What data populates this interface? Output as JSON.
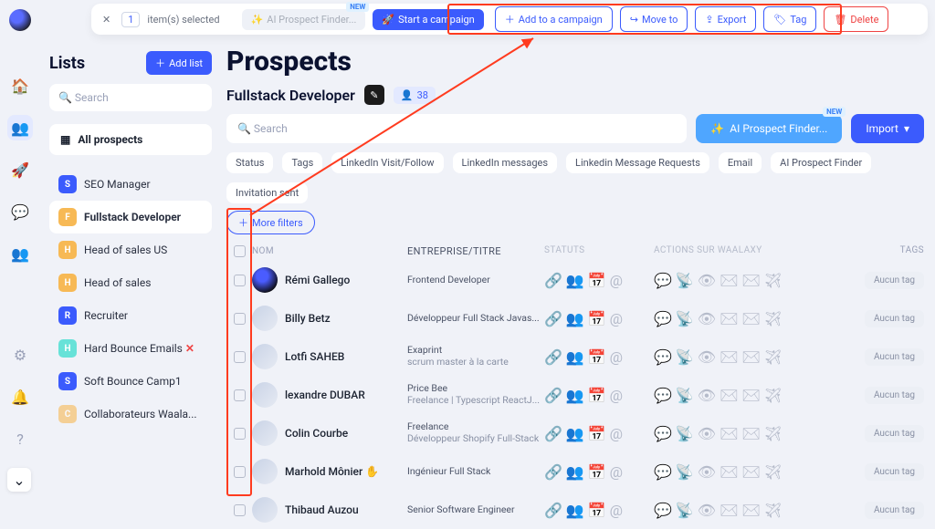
{
  "topbar": {
    "selected_count": "1",
    "selected_label": "item(s) selected",
    "ai_btn": "AI Prospect Finder...",
    "new_badge": "NEW",
    "start_campaign": "Start a campaign",
    "add_to_campaign": "Add to a campaign",
    "move_to": "Move to",
    "export": "Export",
    "tag": "Tag",
    "delete": "Delete"
  },
  "sidebar": {
    "title": "Lists",
    "add_list": "Add list",
    "search_placeholder": "Search",
    "all_prospects": "All prospects",
    "items": [
      {
        "initial": "S",
        "cls": "la-s",
        "label": "SEO Manager"
      },
      {
        "initial": "F",
        "cls": "la-f",
        "label": "Fullstack Developer",
        "active": true
      },
      {
        "initial": "H",
        "cls": "la-h",
        "label": "Head of sales US"
      },
      {
        "initial": "H",
        "cls": "la-h",
        "label": "Head of sales"
      },
      {
        "initial": "R",
        "cls": "la-r",
        "label": "Recruiter"
      },
      {
        "initial": "H",
        "cls": "la-h2",
        "label": "Hard Bounce Emails",
        "x": true
      },
      {
        "initial": "S",
        "cls": "la-s",
        "label": "Soft Bounce Camp1"
      },
      {
        "initial": "C",
        "cls": "la-c",
        "label": "Collaborateurs Waala..."
      }
    ]
  },
  "main": {
    "heading": "Prospects",
    "subtitle": "Fullstack Developer",
    "count": "38",
    "search_placeholder": "Search",
    "ai_finder": "AI Prospect Finder...",
    "new_badge": "NEW",
    "import": "Import",
    "filters": [
      "Status",
      "Tags",
      "LinkedIn Visit/Follow",
      "LinkedIn messages",
      "Linkedin Message Requests",
      "Email",
      "AI Prospect Finder",
      "Invitation sent"
    ],
    "more_filters": "More filters",
    "columns": {
      "nom": "NOM",
      "ent": "ENTREPRISE/TITRE",
      "stat": "STATUTS",
      "act": "ACTIONS SUR WAALAXY",
      "tag": "TAGS"
    },
    "no_tag": "Aucun tag",
    "rows": [
      {
        "name": "Rémi Gallego",
        "l1": "Frontend Developer",
        "l2": "",
        "alien": true
      },
      {
        "name": "Billy Betz",
        "l1": "Développeur Full Stack Javas...",
        "l2": ""
      },
      {
        "name": "Lotfi SAHEB",
        "l1": "Exaprint",
        "l2": "scrum master à la carte"
      },
      {
        "name": "lexandre DUBAR",
        "l1": "Price Bee",
        "l2": "Freelance | Typescript ReactJ...",
        "apple": true
      },
      {
        "name": "Colin Courbe",
        "l1": "Freelance",
        "l2": "Développeur Shopify Full-Stack"
      },
      {
        "name": "Marhold Mônier ✋",
        "l1": "Ingénieur Full Stack",
        "l2": ""
      },
      {
        "name": "Thibaud Auzou",
        "l1": "Senior Software Engineer",
        "l2": ""
      }
    ]
  }
}
